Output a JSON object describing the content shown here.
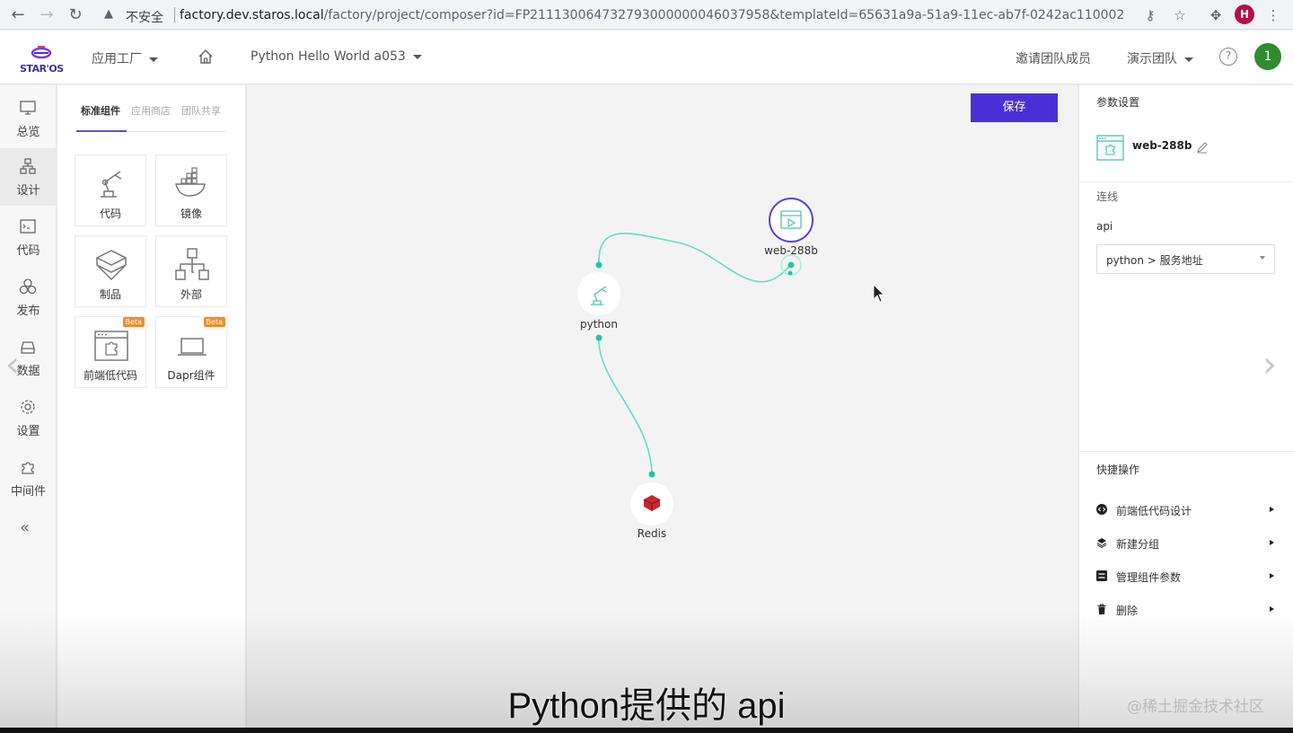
{
  "browser": {
    "insecure_label": "不安全",
    "url_host": "factory.dev.staros.local",
    "url_path": "/factory/project/composer?id=FP211130064732793000000046037958&templateId=65631a9a-51a9-11ec-ab7f-0242ac110002",
    "profile_initial": "H"
  },
  "header": {
    "logo_text": "STAR'OS",
    "app_factory": "应用工厂",
    "project_name": "Python Hello World a053",
    "invite_members": "邀请团队成员",
    "team_name": "演示团队",
    "help": "?",
    "avatar_initial": "1"
  },
  "left_nav": {
    "items": [
      {
        "label": "总览",
        "icon": "monitor-icon"
      },
      {
        "label": "设计",
        "icon": "design-icon"
      },
      {
        "label": "代码",
        "icon": "code-icon"
      },
      {
        "label": "发布",
        "icon": "publish-icon"
      },
      {
        "label": "数据",
        "icon": "database-icon"
      },
      {
        "label": "设置",
        "icon": "gear-icon"
      },
      {
        "label": "中间件",
        "icon": "puzzle-icon"
      }
    ],
    "collapse": "«"
  },
  "components": {
    "tabs": [
      "标准组件",
      "应用商店",
      "团队共享"
    ],
    "cards": [
      {
        "label": "代码",
        "icon": "robot-arm-icon",
        "beta": false
      },
      {
        "label": "镜像",
        "icon": "docker-icon",
        "beta": false
      },
      {
        "label": "制品",
        "icon": "package-icon",
        "beta": false
      },
      {
        "label": "外部",
        "icon": "network-icon",
        "beta": false
      },
      {
        "label": "前端低代码",
        "icon": "lowcode-icon",
        "beta": true
      },
      {
        "label": "Dapr组件",
        "icon": "laptop-icon",
        "beta": true
      }
    ],
    "beta_label": "Beta"
  },
  "canvas": {
    "save_label": "保存",
    "nodes": [
      {
        "label": "web-288b",
        "icon": "web-icon"
      },
      {
        "label": "python",
        "icon": "robot-arm-icon"
      },
      {
        "label": "Redis",
        "icon": "redis-icon"
      }
    ]
  },
  "right_panel": {
    "param_title": "参数设置",
    "component_name": "web-288b",
    "connection_title": "连线",
    "api_label": "api",
    "api_value": "python > 服务地址",
    "quick_title": "快捷操作",
    "quick_actions": [
      {
        "label": "前端低代码设计",
        "icon": "code-circle-icon"
      },
      {
        "label": "新建分组",
        "icon": "layers-icon"
      },
      {
        "label": "管理组件参数",
        "icon": "params-icon"
      },
      {
        "label": "删除",
        "icon": "trash-icon"
      }
    ]
  },
  "video": {
    "subtitle": "Python提供的 api",
    "watermark": "@稀土掘金技术社区"
  },
  "colors": {
    "accent": "#4b2fd6",
    "edge": "#5fe0c4",
    "node_dot": "#22c7a3"
  }
}
